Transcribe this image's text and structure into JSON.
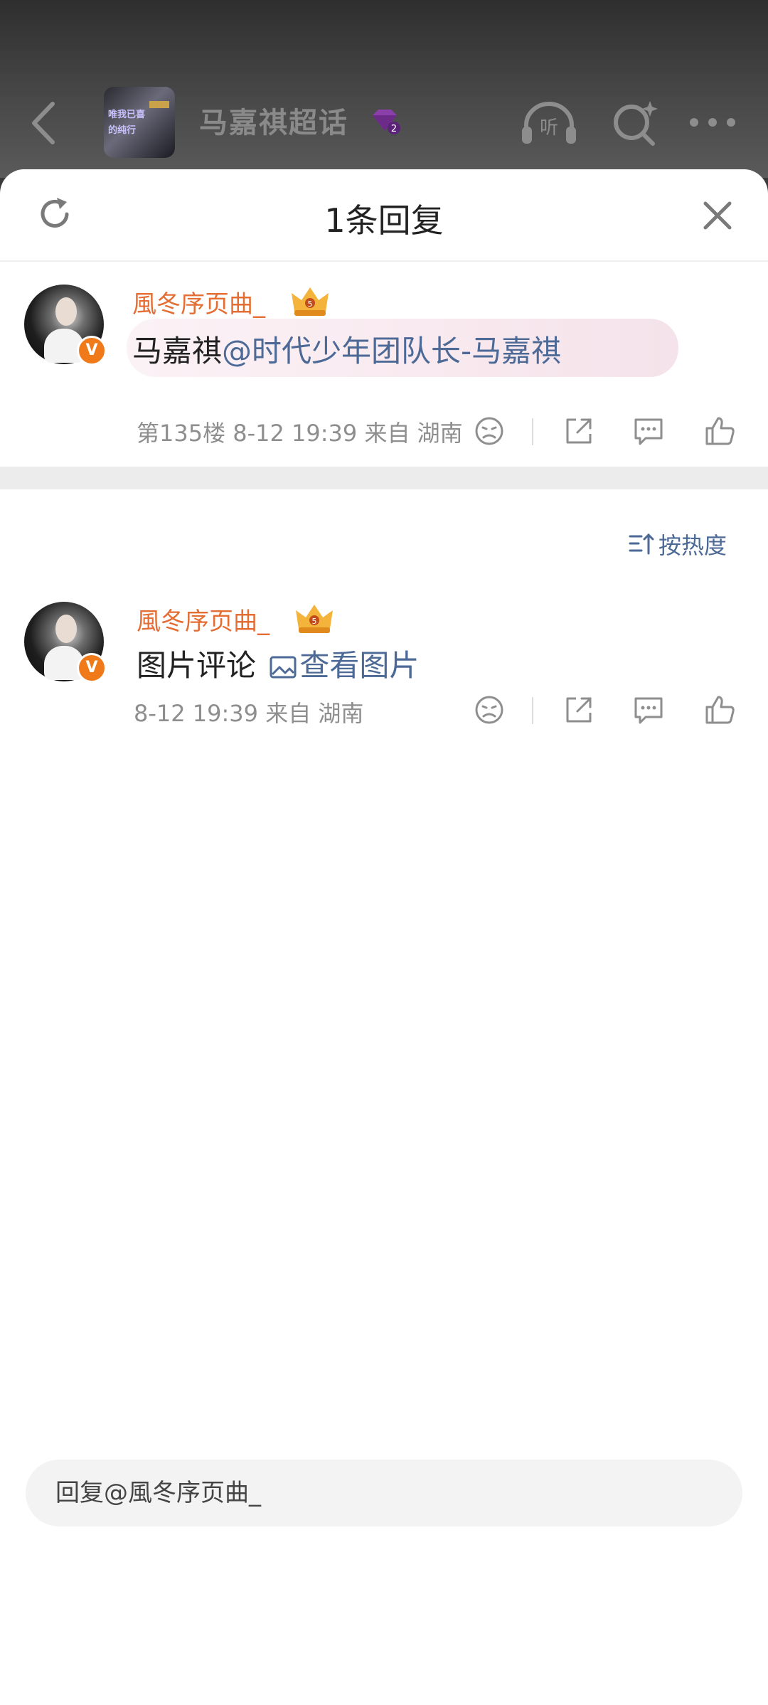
{
  "header": {
    "title": "马嘉祺超话",
    "thumbnail_text_line1": "唯我已喜",
    "thumbnail_text_line2": "的纯行"
  },
  "sheet": {
    "title": "1条回复"
  },
  "original_comment": {
    "username": "風冬序页曲_",
    "text_prefix": "马嘉祺",
    "mention": "@时代少年团队长-马嘉祺",
    "meta": "第135楼 8-12 19:39 来自 湖南",
    "badge": "V"
  },
  "sort": {
    "label": "按热度"
  },
  "replies": [
    {
      "username": "風冬序页曲_",
      "text": "图片评论",
      "link_text": "查看图片",
      "meta": "8-12 19:39 来自 湖南",
      "badge": "V"
    }
  ],
  "reply_box": {
    "placeholder": "回复@風冬序页曲_"
  },
  "colors": {
    "username": "#e46d34",
    "link": "#4d6a97",
    "verified_badge": "#f07a1a",
    "gem": "#8b3fa8"
  },
  "icons": [
    "back-arrow-icon",
    "listen-headphone-icon",
    "search-icon",
    "more-icon",
    "refresh-icon",
    "close-icon",
    "crown-icon",
    "emotion-icon",
    "share-icon",
    "comment-icon",
    "like-icon",
    "sort-icon",
    "image-icon",
    "gem-icon"
  ]
}
